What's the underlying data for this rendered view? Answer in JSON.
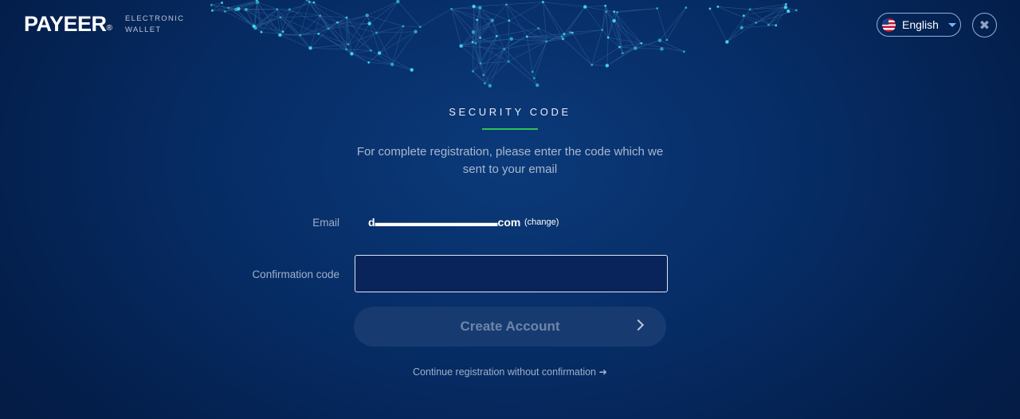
{
  "header": {
    "logo_text": "PAYEER",
    "logo_mark": "®",
    "tagline": "ELECTRONIC\nWALLET",
    "language": {
      "label": "English",
      "icon": "us-flag-icon"
    },
    "close_icon": "✖"
  },
  "form": {
    "title": "SECURITY CODE",
    "instructions": "For complete registration, please enter the code which we sent to your email",
    "email_label": "Email",
    "email_value": "d▬▬▬▬▬▬▬▬▬▬▬com",
    "change_label": "(change)",
    "code_label": "Confirmation code",
    "code_value": "",
    "submit_label": "Create Account",
    "continue_label": "Continue registration without confirmation ➜"
  },
  "colors": {
    "accent_underline": "#2fc25a",
    "background": "#062b63",
    "button_bg": "#173b70"
  }
}
